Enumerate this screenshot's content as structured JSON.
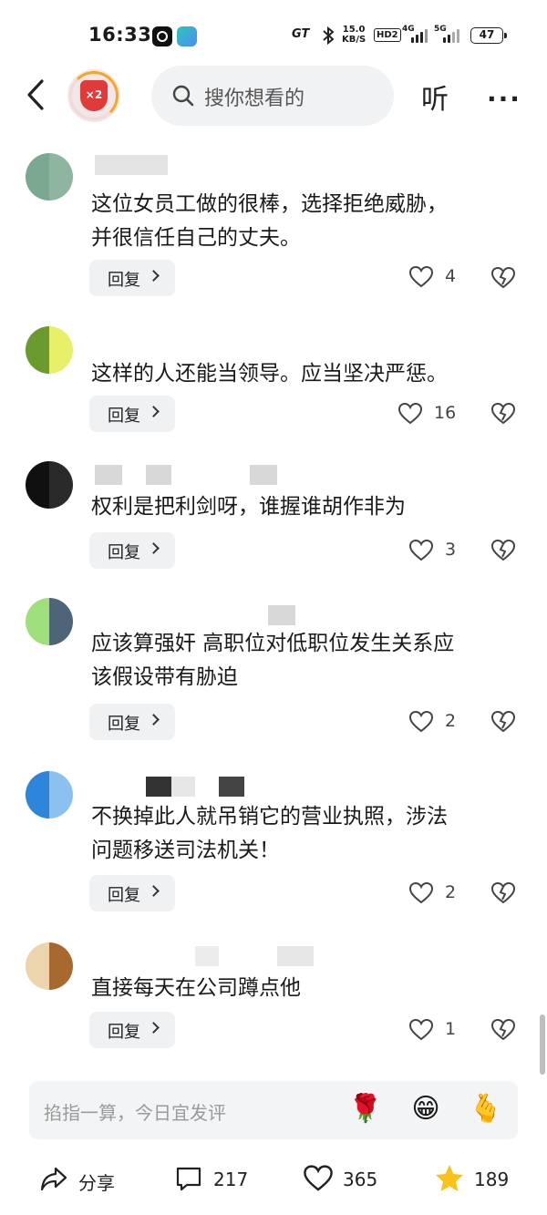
{
  "status_bar": {
    "time": "16:33",
    "carrier_badge": "GT",
    "net_speed_value": "15.0",
    "net_speed_unit": "KB/S",
    "hd_badge": "HD2",
    "signal_1_label": "4G",
    "signal_2_label": "5G",
    "battery": "47"
  },
  "header": {
    "back_icon": "chevron-left-icon",
    "badge_text": "×2",
    "search_placeholder": "搜你想看的",
    "listen_label": "听",
    "more_label": "···"
  },
  "comments": [
    {
      "avatar_colors": [
        "#7aa890",
        "#8fb4a0"
      ],
      "text_line1": "这位女员工做的很棒，选择拒绝威胁，",
      "text_line2": "并很信任自己的丈夫。",
      "reply_label": "回复",
      "likes": "4"
    },
    {
      "avatar_colors": [
        "#6b9a2e",
        "#e8f06a"
      ],
      "text_line1": "这样的人还能当领导。应当坚决严惩。",
      "text_line2": "",
      "reply_label": "回复",
      "likes": "16"
    },
    {
      "avatar_colors": [
        "#101010",
        "#2a2a2a"
      ],
      "text_line1": "权利是把利剑呀，谁握谁胡作非为",
      "text_line2": "",
      "reply_label": "回复",
      "likes": "3"
    },
    {
      "avatar_colors": [
        "#9fe07c",
        "#4e6577"
      ],
      "text_line1": "应该算强奸 高职位对低职位发生关系应",
      "text_line2": "该假设带有胁迫",
      "reply_label": "回复",
      "likes": "2"
    },
    {
      "avatar_colors": [
        "#2d86d9",
        "#8cc1ef"
      ],
      "text_line1": "不换掉此人就吊销它的营业执照，涉法",
      "text_line2": "问题移送司法机关！",
      "reply_label": "回复",
      "likes": "2"
    },
    {
      "avatar_colors": [
        "#ecd5ad",
        "#a7692f"
      ],
      "text_line1": "直接每天在公司蹲点他",
      "text_line2": "",
      "reply_label": "回复",
      "likes": "1"
    }
  ],
  "comment_input": {
    "placeholder": "掐指一算，今日宜发评",
    "emoji_1": "🌹",
    "emoji_2": "😁",
    "emoji_3": "🫰"
  },
  "bottom_bar": {
    "share_label": "分享",
    "comments_count": "217",
    "likes_count": "365",
    "favorites_count": "189"
  },
  "colors": {
    "accent_star": "#f7c21a",
    "badge_red": "#e03a3a",
    "text": "#1a1a1a"
  }
}
